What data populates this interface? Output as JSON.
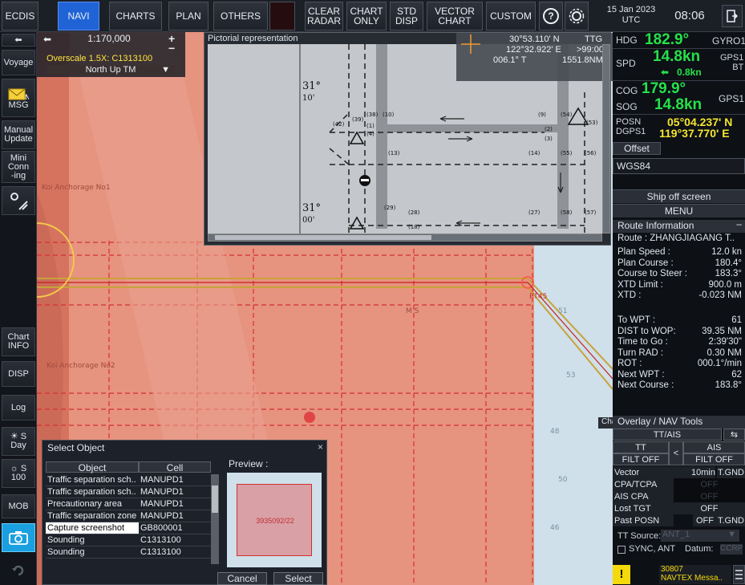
{
  "topbar": {
    "ecdis": "ECDIS",
    "navi": "NAVI",
    "charts": "CHARTS",
    "plan": "PLAN",
    "others": "OTHERS",
    "clear_radar": "CLEAR\nRADAR",
    "chart_only": "CHART\nONLY",
    "std_disp": "STD\nDISP",
    "vector_chart": "VECTOR\nCHART",
    "custom": "CUSTOM",
    "help_icon": "?",
    "date": "15 Jan 2023\nUTC",
    "time": "08:06",
    "icons": [
      "help-icon",
      "settings-icon",
      "exit-icon"
    ]
  },
  "leftbar": {
    "back": "⬅",
    "voyage": "Voyage",
    "msg": "MSG",
    "manual_update": "Manual\nUpdate",
    "mini_conning": "Mini\nConn\n-ing",
    "chart_info": "Chart\nINFO",
    "disp": "DISP",
    "log": "Log",
    "day": "Day",
    "brightness": "100",
    "mob": "MOB",
    "icons": [
      "msg-envelope-icon",
      "settings-icon",
      "sun-icon",
      "camera-icon",
      "night-icon"
    ]
  },
  "chart": {
    "scale": "1:170,000",
    "overscale": "Overscale 1.5X: C1313100",
    "orientation": "North Up TM",
    "mini_label": "Chart",
    "labels": [
      "Koi Anchorage No1",
      "Anchorage No2",
      "PT45",
      "M S"
    ]
  },
  "pictorial": {
    "title": "Pictorial representation",
    "lat_top": "31°",
    "lat_top_min": "10'",
    "lat_bottom": "31°",
    "lat_bottom_min": "00'",
    "info_lat": "30°53.110' N",
    "info_ttg_label": "TTG",
    "info_lon": "122°32.922' E",
    "info_ttg": ">99:00",
    "info_brg": "006.1° T",
    "info_dist": "1551.8NM"
  },
  "ownship": {
    "hdg_label": "HDG",
    "hdg": "182.9°",
    "hdg_src": "GYRO1",
    "spd_label": "SPD",
    "spd": "14.8kn",
    "spd_src": "GPS1\nBT",
    "drift": "0.8kn",
    "cog_label": "COG",
    "cog": "179.9°",
    "sog_label": "SOG",
    "sog": "14.8kn",
    "cogsog_src": "GPS1",
    "posn_label": "POSN\nDGPS1",
    "lat": "05°04.237' N",
    "lon": "119°37.770' E",
    "offset": "Offset",
    "datum": "WGS84"
  },
  "panel": {
    "ship_off_screen": "Ship off screen",
    "menu": "MENU",
    "route_info_title": "Route Information",
    "route": "Route : ZHANGJIAGANG T..",
    "rows1": [
      {
        "k": "Plan Speed :",
        "v": "12.0 kn"
      },
      {
        "k": "Plan Course :",
        "v": "180.4°"
      },
      {
        "k": "Course to Steer :",
        "v": "183.3°"
      },
      {
        "k": "XTD Limit :",
        "v": "900.0 m"
      },
      {
        "k": "XTD :",
        "v": "-0.023 NM"
      }
    ],
    "rows2": [
      {
        "k": "To WPT :",
        "v": "61"
      },
      {
        "k": "DIST to WOP:",
        "v": "39.35 NM"
      },
      {
        "k": "Time to Go :",
        "v": "2:39'30\""
      },
      {
        "k": "Turn RAD :",
        "v": "0.30 NM"
      },
      {
        "k": "ROT :",
        "v": "000.1°/min"
      },
      {
        "k": "Next WPT :",
        "v": "62"
      },
      {
        "k": "Next Course :",
        "v": "183.8°"
      }
    ],
    "overlay_title": "Overlay / NAV Tools",
    "tt_ais": "TT/AIS",
    "tt": "TT",
    "ais": "AIS",
    "tt_filt": "FILT OFF",
    "ais_filt": "FILT OFF",
    "vector_label": "Vector",
    "vector_val": "10min",
    "vector_mode": "T.GND",
    "cpa_tcpa": "CPA/TCPA",
    "cpa_tcpa_val": "OFF",
    "ais_cpa": "AIS CPA",
    "ais_cpa_val": "OFF",
    "lost_tgt": "Lost TGT",
    "lost_tgt_val": "OFF",
    "past_posn": "Past POSN",
    "past_posn_val": "OFF",
    "past_posn_mode": "T.GND",
    "tt_source_label": "TT Source:",
    "tt_source_val": "ANT_1",
    "sync_ant": "SYNC, ANT",
    "datum_label": "Datum:",
    "datum_val": "CCRP",
    "alert_code": "30807",
    "alert_text": "NAVTEX Messa.."
  },
  "dialog": {
    "title": "Select Object",
    "close": "×",
    "col_object": "Object",
    "col_cell": "Cell",
    "rows": [
      {
        "object": "Traffic separation sch..",
        "cell": "MANUPD1"
      },
      {
        "object": "Traffic separation sch..",
        "cell": "MANUPD1"
      },
      {
        "object": "Precautionary area",
        "cell": "MANUPD1"
      },
      {
        "object": "Traffic separation zone",
        "cell": "MANUPD1"
      },
      {
        "object": "Capture screenshot",
        "cell": "GB800001"
      },
      {
        "object": "Sounding",
        "cell": "C1313100"
      },
      {
        "object": "Sounding",
        "cell": "C1313100"
      }
    ],
    "preview_label": "Preview :",
    "preview_text": "3935092/22",
    "cancel": "Cancel",
    "select": "Select"
  }
}
